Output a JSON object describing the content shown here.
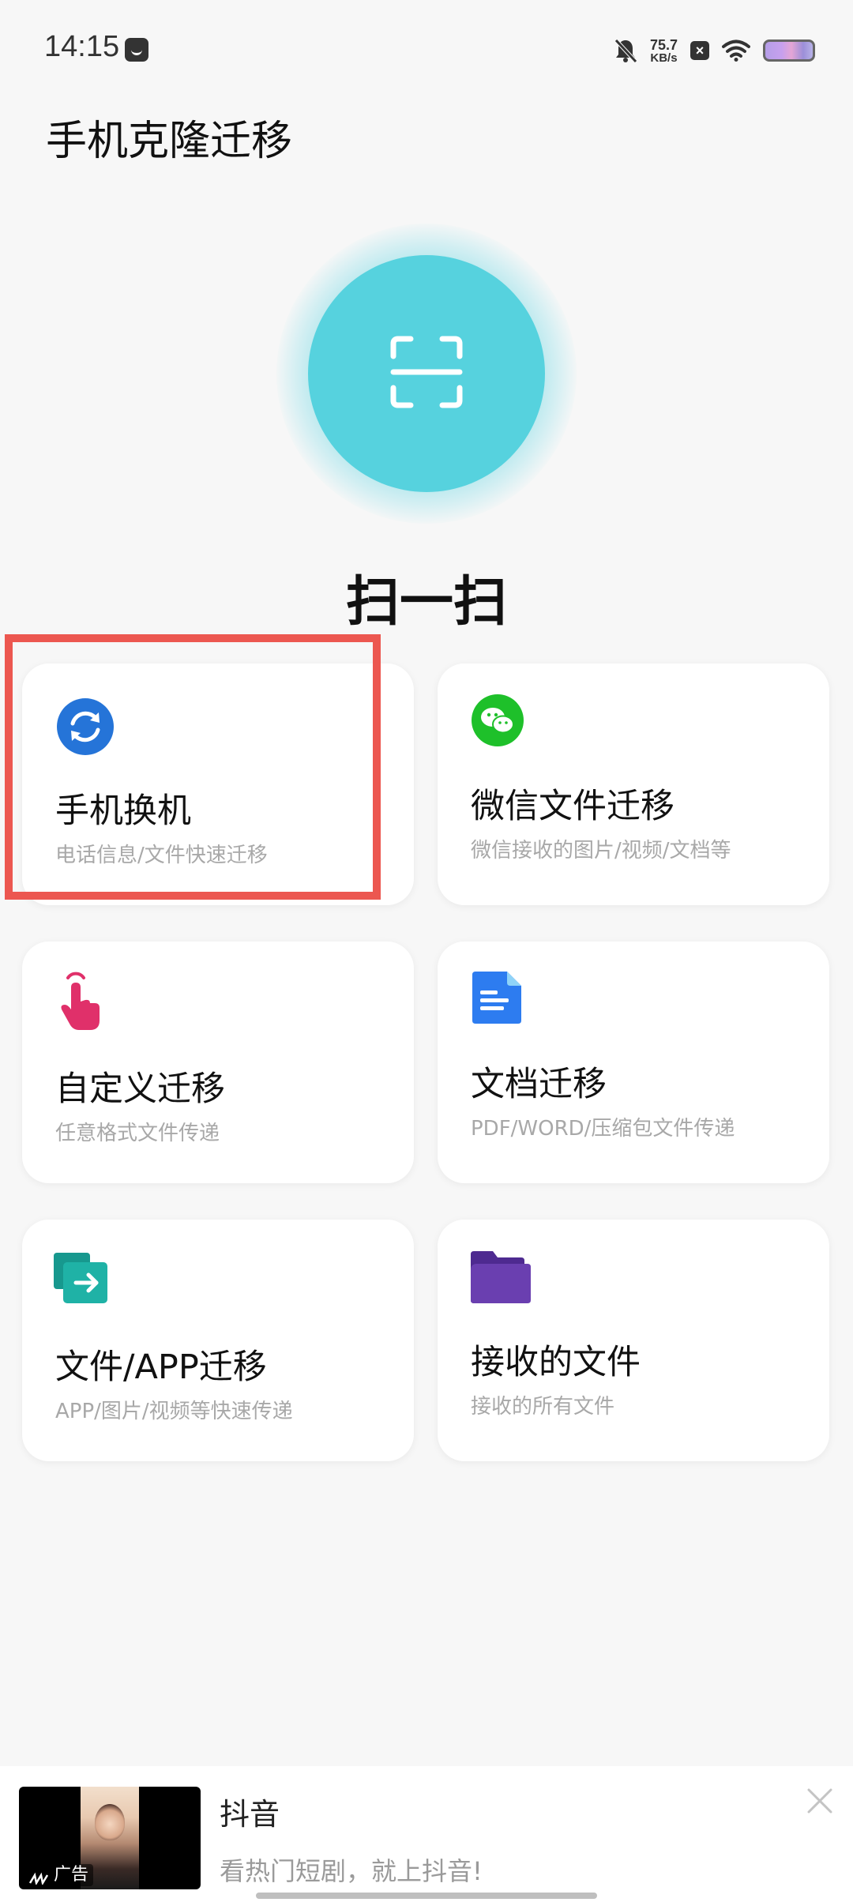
{
  "status_bar": {
    "time": "14:15",
    "net_speed_value": "75.7",
    "net_speed_unit": "KB/s",
    "x_badge": "×"
  },
  "page": {
    "title": "手机克隆迁移"
  },
  "scan": {
    "label": "扫一扫",
    "accent_color": "#56d2de"
  },
  "cards": [
    {
      "title": "手机换机",
      "subtitle": "电话信息/文件快速迁移",
      "icon": "sync-icon",
      "icon_color": "#2574d8"
    },
    {
      "title": "微信文件迁移",
      "subtitle": "微信接收的图片/视频/文档等",
      "icon": "wechat-icon",
      "icon_color": "#1ec02a"
    },
    {
      "title": "自定义迁移",
      "subtitle": "任意格式文件传递",
      "icon": "tap-hand-icon",
      "icon_color": "#e0306a"
    },
    {
      "title": "文档迁移",
      "subtitle": "PDF/WORD/压缩包文件传递",
      "icon": "document-icon",
      "icon_color": "#2d7cf0"
    },
    {
      "title": "文件/APP迁移",
      "subtitle": "APP/图片/视频等快速传递",
      "icon": "file-transfer-icon",
      "icon_color": "#1fb2a6"
    },
    {
      "title": "接收的文件",
      "subtitle": "接收的所有文件",
      "icon": "folder-icon",
      "icon_color": "#6a3fb0"
    }
  ],
  "highlight_color": "#ec5750",
  "ad": {
    "badge": "广告",
    "title": "抖音",
    "description": "看热门短剧，就上抖音!"
  }
}
